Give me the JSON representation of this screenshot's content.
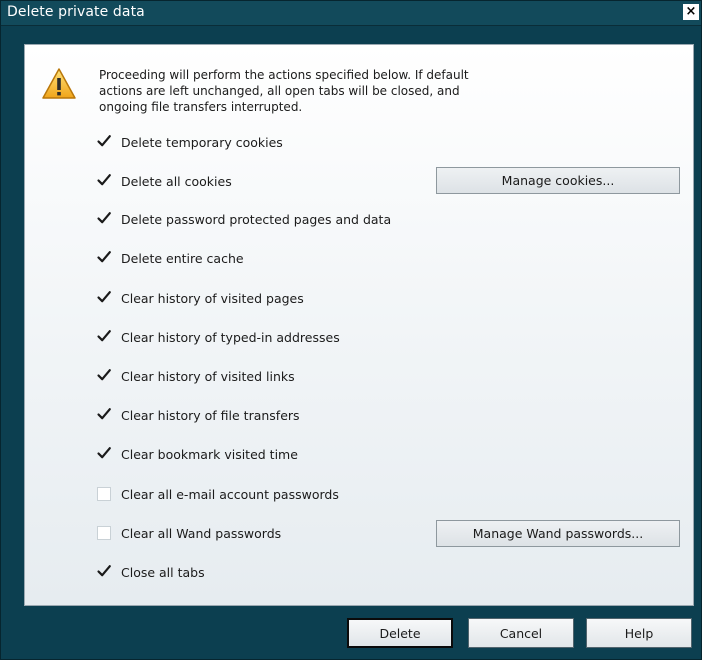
{
  "window": {
    "title": "Delete private data",
    "close_label": "×"
  },
  "intro": "Proceeding will perform the actions specified below. If default actions are left unchanged, all open tabs will be closed, and ongoing file transfers interrupted.",
  "options": [
    {
      "label": "Delete temporary cookies",
      "checked": true
    },
    {
      "label": "Delete all cookies",
      "checked": true
    },
    {
      "label": "Delete password protected pages and data",
      "checked": true
    },
    {
      "label": "Delete entire cache",
      "checked": true
    },
    {
      "label": "Clear history of visited pages",
      "checked": true
    },
    {
      "label": "Clear history of typed-in addresses",
      "checked": true
    },
    {
      "label": "Clear history of visited links",
      "checked": true
    },
    {
      "label": "Clear history of file transfers",
      "checked": true
    },
    {
      "label": "Clear bookmark visited time",
      "checked": true
    },
    {
      "label": "Clear all e-mail account passwords",
      "checked": false
    },
    {
      "label": "Clear all Wand passwords",
      "checked": false
    },
    {
      "label": "Close all tabs",
      "checked": true
    }
  ],
  "buttons": {
    "manage_cookies": "Manage cookies...",
    "manage_wand": "Manage Wand passwords...",
    "delete": "Delete",
    "cancel": "Cancel",
    "help": "Help"
  }
}
